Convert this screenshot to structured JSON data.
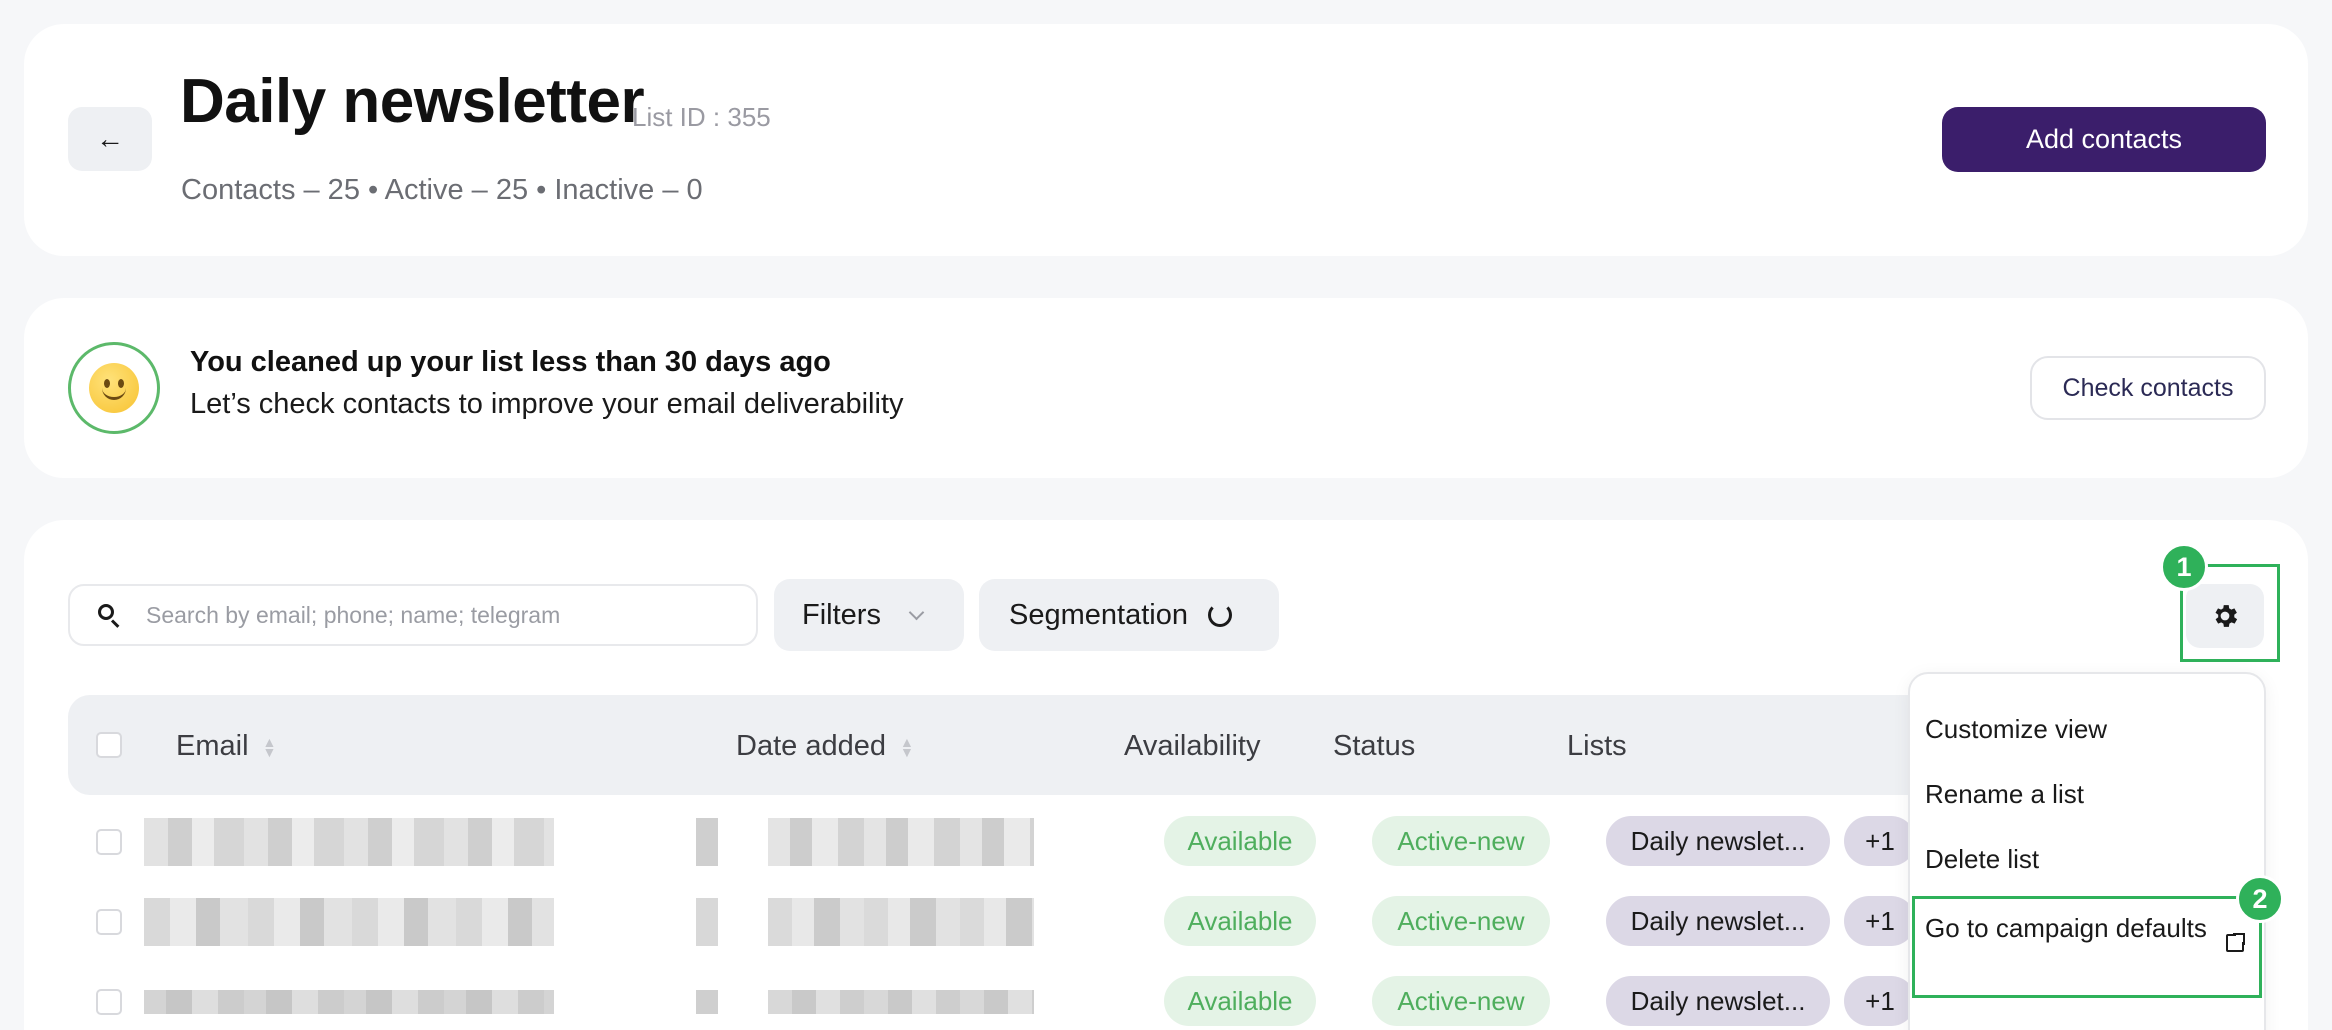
{
  "header": {
    "back_label": "←",
    "title": "Daily newsletter",
    "list_id": "List ID : 355",
    "stats": "Contacts – 25 • Active – 25 • Inactive – 0",
    "add_contacts_label": "Add contacts"
  },
  "notice": {
    "title": "You cleaned up your list less than 30 days ago",
    "subtitle": "Let’s check contacts to improve your email deliverability",
    "check_contacts_label": "Check contacts"
  },
  "toolbar": {
    "search_placeholder": "Search by email; phone; name; telegram",
    "filters_label": "Filters",
    "segmentation_label": "Segmentation"
  },
  "table": {
    "columns": {
      "email": "Email",
      "date_added": "Date added",
      "availability": "Availability",
      "status": "Status",
      "lists": "Lists"
    },
    "rows": [
      {
        "availability": "Available",
        "status": "Active-new",
        "list": "Daily newslet...",
        "more": "+1"
      },
      {
        "availability": "Available",
        "status": "Active-new",
        "list": "Daily newslet...",
        "more": "+1"
      },
      {
        "availability": "Available",
        "status": "Active-new",
        "list": "Daily newslet...",
        "more": "+1"
      }
    ]
  },
  "settings_menu": {
    "items": [
      "Customize view",
      "Rename a list",
      "Delete list",
      "Go to campaign defaults"
    ]
  },
  "annotations": {
    "badge_1": "1",
    "badge_2": "2",
    "highlight_color": "#2fb15a"
  },
  "colors": {
    "primary": "#3b1e6b",
    "success": "#4fae5d",
    "list_pill": "#dcd8e6"
  }
}
